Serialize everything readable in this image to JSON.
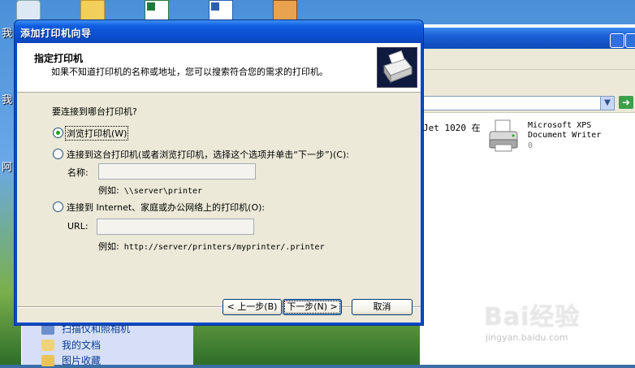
{
  "dialog": {
    "title": "添加打印机向导",
    "header_title": "指定打印机",
    "header_subtitle": "如果不知道打印机的名称或地址，您可以搜索符合您的需求的打印机。",
    "question": "要连接到哪台打印机?",
    "options": [
      {
        "label": "浏览打印机(W)",
        "checked": true
      },
      {
        "label": "连接到这台打印机(或者浏览打印机，选择这个选项并单击“下一步”)(C):",
        "checked": false
      },
      {
        "label": "连接到 Internet、家庭或办公网络上的打印机(O):",
        "checked": false
      }
    ],
    "name_label": "名称:",
    "name_value": "",
    "name_example_prefix": "例如:",
    "name_example": "\\\\server\\printer",
    "url_label": "URL:",
    "url_value": "",
    "url_example_prefix": "例如:",
    "url_example": "http://server/printers/myprinter/.printer",
    "buttons": {
      "back": "< 上一步(B)",
      "next": "下一步(N) >",
      "cancel": "取消"
    }
  },
  "background": {
    "printer_1_label": "Jet 1020 在",
    "printer_2_label_line1": "Microsoft XPS",
    "printer_2_label_line2": "Document Writer",
    "printer_2_count": "0",
    "task_items": [
      "扫描仪和照相机",
      "我的文档",
      "图片收藏"
    ]
  },
  "watermark": {
    "logo": "Bai经验",
    "url": "jingyan.baidu.com"
  },
  "colors": {
    "titlebar_blue": "#0a4fd0",
    "dialog_face": "#ece9d8",
    "radio_dot": "#21a121",
    "button_border": "#003c74"
  },
  "icons": {
    "header": "printer-wizard-icon",
    "printer": "printer-icon",
    "address_go": "go-arrow-icon"
  }
}
